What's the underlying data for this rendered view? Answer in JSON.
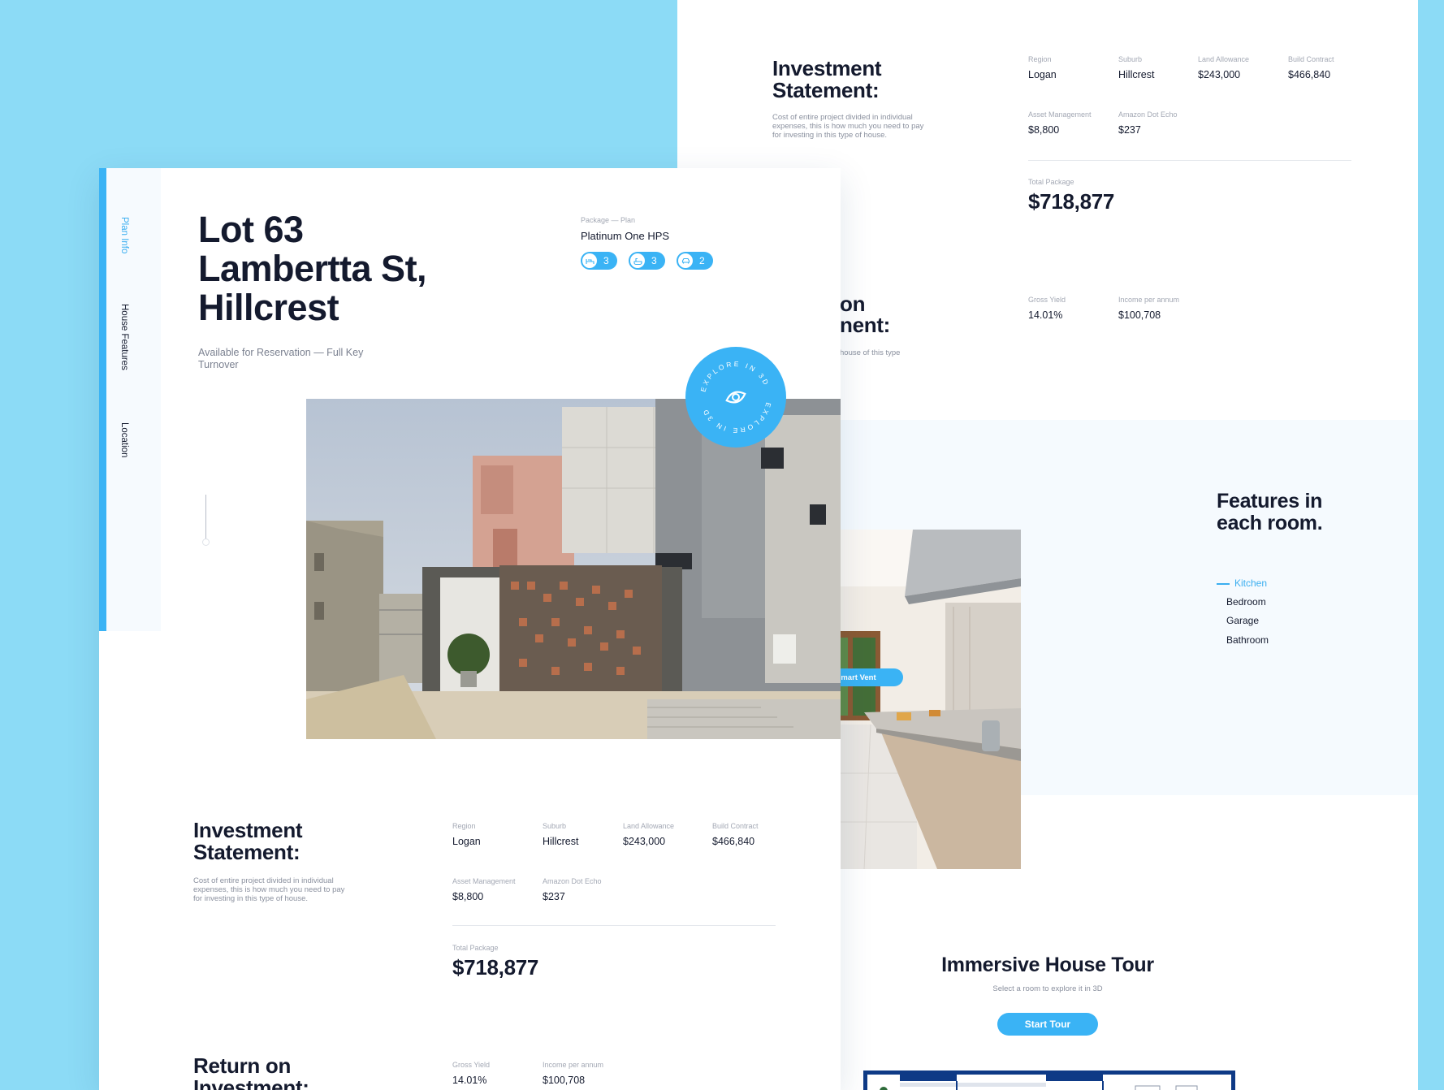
{
  "colors": {
    "background": "#8CDBF6",
    "accent": "#3AB3F5",
    "text": "#141a2e"
  },
  "back_page": {
    "investment": {
      "title": "Investment Statement:",
      "description": "Cost of entire project divided in individual expenses, this is how much you need to pay for investing in this type of house.",
      "items": [
        {
          "label": "Region",
          "value": "Logan"
        },
        {
          "label": "Suburb",
          "value": "Hillcrest"
        },
        {
          "label": "Land Allowance",
          "value": "$243,000"
        },
        {
          "label": "Build Contract",
          "value": "$466,840"
        },
        {
          "label": "Asset Management",
          "value": "$8,800"
        },
        {
          "label": "Amazon Dot Echo",
          "value": "$237"
        }
      ],
      "total_label": "Total Package",
      "total_value": "$718,877"
    },
    "return": {
      "title_fragment_1": "on",
      "title_fragment_2": "nent:",
      "desc_fragment": "house of this type",
      "items": [
        {
          "label": "Gross Yield",
          "value": "14.01%"
        },
        {
          "label": "Income per annum",
          "value": "$100,708"
        }
      ]
    },
    "features": {
      "title": "Features in each room.",
      "rooms": [
        "Kitchen",
        "Bedroom",
        "Garage",
        "Bathroom"
      ],
      "active_room": "Kitchen",
      "hotspot_label": "Smart Vent"
    },
    "tour": {
      "title": "Immersive House Tour",
      "subtitle": "Select a room to explore it in 3D",
      "button": "Start Tour"
    }
  },
  "front_page": {
    "nav": [
      "Plan Info",
      "House Features",
      "Location"
    ],
    "nav_active": "Plan Info",
    "title": "Lot 63 Lambertta St, Hillcrest",
    "subtitle": "Available for Reservation — Full Key Turnover",
    "package_label": "Package — Plan",
    "package_name": "Platinum One HPS",
    "pills": [
      {
        "icon": "bed-icon",
        "value": "3"
      },
      {
        "icon": "bath-icon",
        "value": "3"
      },
      {
        "icon": "car-icon",
        "value": "2"
      }
    ],
    "explore_badge": "EXPLORE IN 3D",
    "investment": {
      "title": "Investment Statement:",
      "description": "Cost of entire project divided in individual expenses, this is how much you need to pay for investing in this type of house.",
      "items": [
        {
          "label": "Region",
          "value": "Logan"
        },
        {
          "label": "Suburb",
          "value": "Hillcrest"
        },
        {
          "label": "Land Allowance",
          "value": "$243,000"
        },
        {
          "label": "Build Contract",
          "value": "$466,840"
        },
        {
          "label": "Asset Management",
          "value": "$8,800"
        },
        {
          "label": "Amazon Dot Echo",
          "value": "$237"
        }
      ],
      "total_label": "Total Package",
      "total_value": "$718,877"
    },
    "return": {
      "title": "Return on Investment:",
      "items": [
        {
          "label": "Gross Yield",
          "value": "14.01%"
        },
        {
          "label": "Income per annum",
          "value": "$100,708"
        }
      ]
    }
  }
}
